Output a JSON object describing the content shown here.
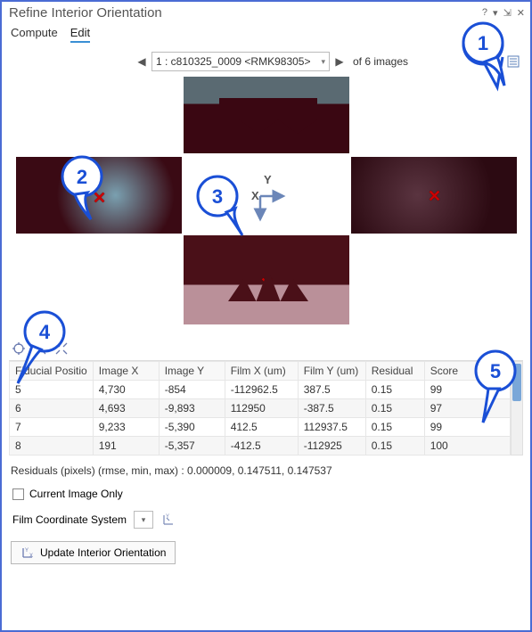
{
  "window": {
    "title": "Refine Interior Orientation"
  },
  "menubar": {
    "compute": "Compute",
    "edit": "Edit"
  },
  "nav": {
    "current_label": "1 : c810325_0009 <RMK98305>",
    "count_label": "of 6 images"
  },
  "axes": {
    "x": "X",
    "y": "Y"
  },
  "table": {
    "columns": [
      "Fiducial Positio",
      "Image X",
      "Image Y",
      "Film X (um)",
      "Film Y (um)",
      "Residual",
      "Score"
    ],
    "rows": [
      {
        "c0": "5",
        "c1": "4,730",
        "c2": "-854",
        "c3": "-112962.5",
        "c4": "387.5",
        "c5": "0.15",
        "c6": "99"
      },
      {
        "c0": "6",
        "c1": "4,693",
        "c2": "-9,893",
        "c3": "112950",
        "c4": "-387.5",
        "c5": "0.15",
        "c6": "97"
      },
      {
        "c0": "7",
        "c1": "9,233",
        "c2": "-5,390",
        "c3": "412.5",
        "c4": "112937.5",
        "c5": "0.15",
        "c6": "99"
      },
      {
        "c0": "8",
        "c1": "191",
        "c2": "-5,357",
        "c3": "-412.5",
        "c4": "-112925",
        "c5": "0.15",
        "c6": "100"
      }
    ]
  },
  "residuals_line": "Residuals (pixels) (rmse, min, max)  : 0.000009, 0.147511, 0.147537",
  "current_image_only": "Current Image Only",
  "film_coord_label": "Film Coordinate System",
  "update_button": "Update Interior Orientation",
  "callouts": {
    "c1": "1",
    "c2": "2",
    "c3": "3",
    "c4": "4",
    "c5": "5"
  }
}
